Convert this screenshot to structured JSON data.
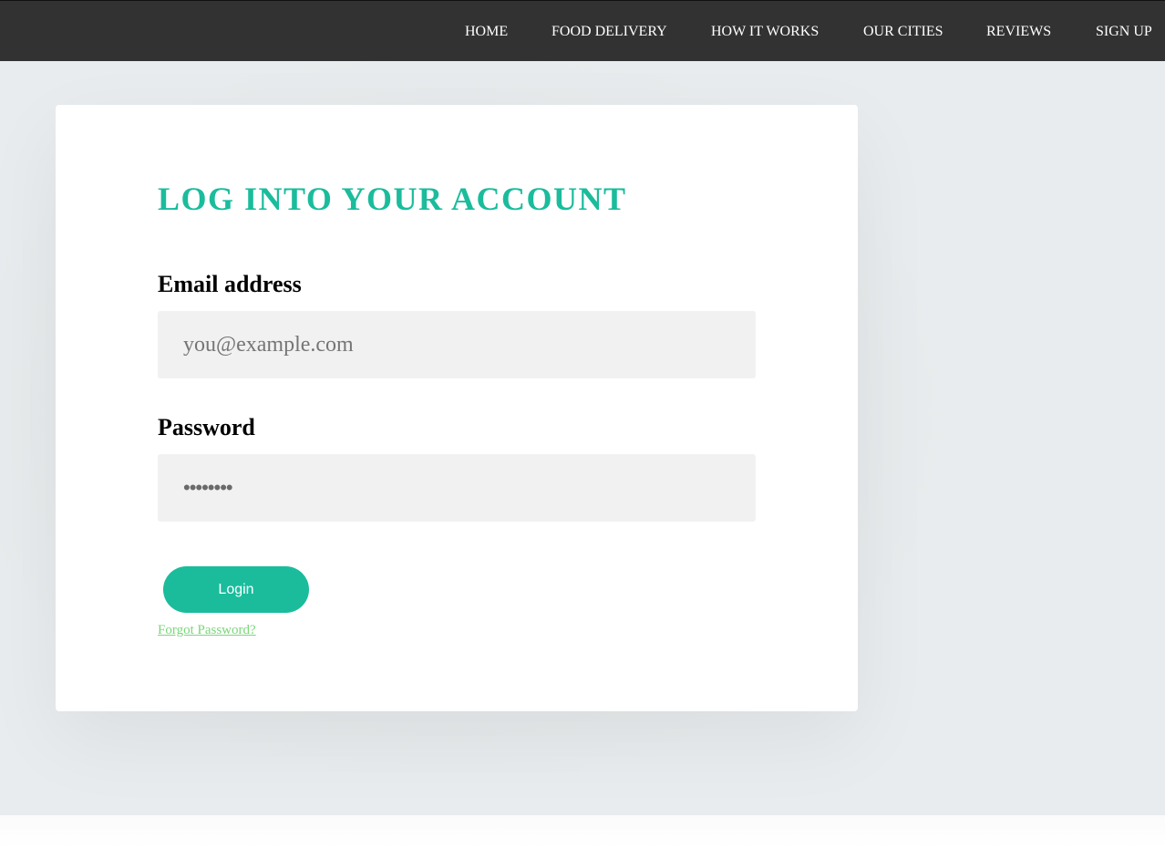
{
  "nav": {
    "items": [
      {
        "label": "HOME"
      },
      {
        "label": "FOOD DELIVERY"
      },
      {
        "label": "HOW IT WORKS"
      },
      {
        "label": "OUR CITIES"
      },
      {
        "label": "REVIEWS"
      },
      {
        "label": "SIGN UP"
      }
    ]
  },
  "login": {
    "title": "LOG INTO YOUR ACCOUNT",
    "email_label": "Email address",
    "email_placeholder": "you@example.com",
    "email_value": "",
    "password_label": "Password",
    "password_value": "••••••••",
    "login_button": "Login",
    "forgot_link": "Forgot Password?"
  },
  "colors": {
    "accent": "#1abc9c",
    "navbar": "#323232",
    "link": "#7ad67a"
  }
}
